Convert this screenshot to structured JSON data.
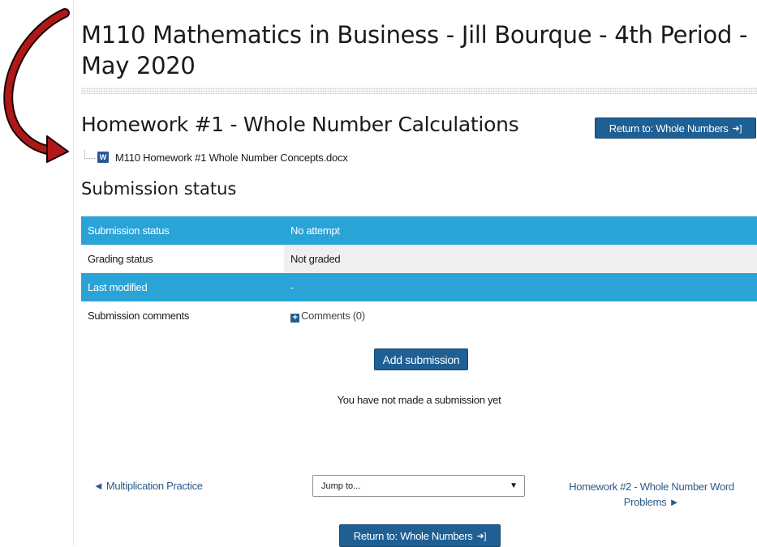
{
  "course": {
    "title": "M110 Mathematics in Business - Jill Bourque - 4th Period - May 2020"
  },
  "assignment": {
    "title": "Homework #1 - Whole Number Calculations",
    "return_button_label": "Return to: Whole Numbers",
    "attachment": {
      "icon": "word-doc-icon",
      "filename": "M110 Homework #1 Whole Number Concepts.docx"
    }
  },
  "submission": {
    "section_title": "Submission status",
    "rows": [
      {
        "label": "Submission status",
        "value": "No attempt"
      },
      {
        "label": "Grading status",
        "value": "Not graded"
      },
      {
        "label": "Last modified",
        "value": "-"
      },
      {
        "label": "Submission comments",
        "value": "Comments (0)"
      }
    ],
    "add_button_label": "Add submission",
    "message": "You have not made a submission yet"
  },
  "navigation": {
    "prev_label": "◄ Multiplication Practice",
    "jump_placeholder": "Jump to...",
    "next_label": "Homework #2 - Whole Number Word Problems ►",
    "return_button_label": "Return to: Whole Numbers"
  },
  "colors": {
    "table_header_blue": "#2aa3d6",
    "button_blue": "#1e5f94",
    "annotation_arrow_red": "#b01818"
  }
}
